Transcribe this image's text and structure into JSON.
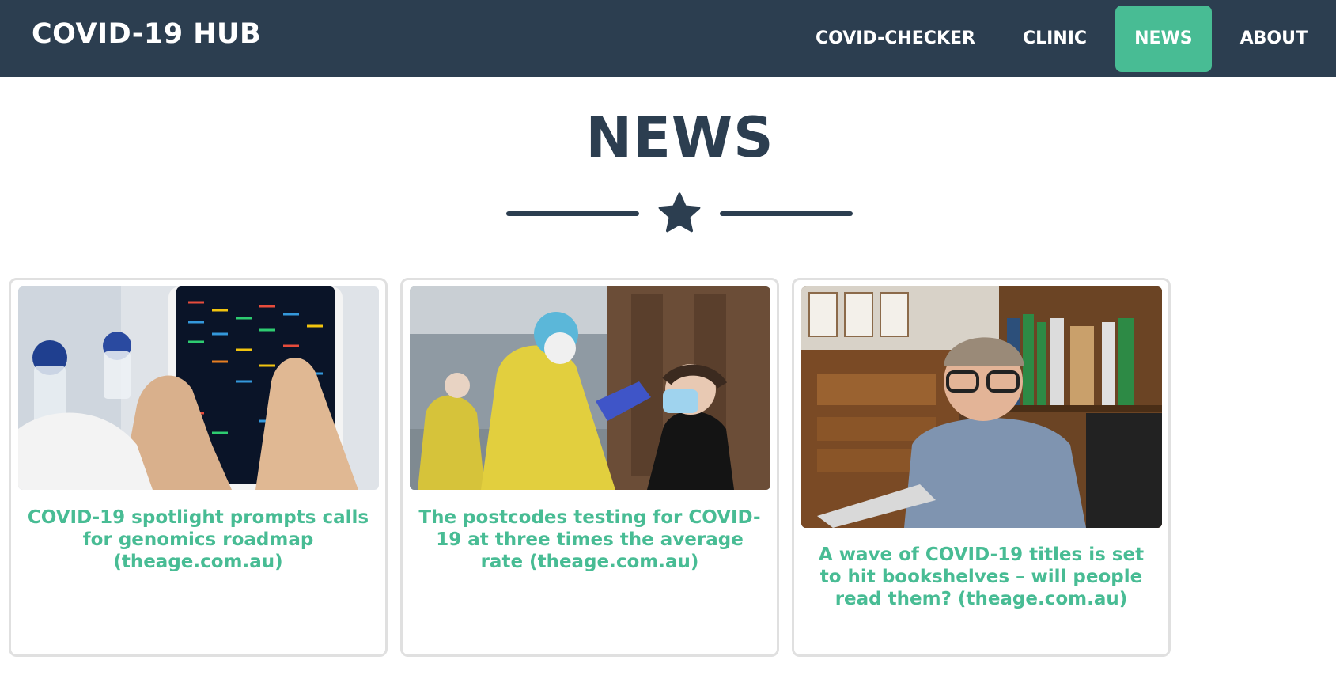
{
  "nav": {
    "brand": "COVID-19 HUB",
    "links": [
      {
        "label": "COVID-CHECKER"
      },
      {
        "label": "CLINIC"
      },
      {
        "label": "NEWS",
        "active": true
      },
      {
        "label": "ABOUT"
      }
    ]
  },
  "page": {
    "title": "NEWS"
  },
  "articles": [
    {
      "title": "COVID-19 spotlight prompts calls for genomics roadmap (theage.com.au)",
      "image": "genome-sequence-tablet-photo"
    },
    {
      "title": "The postcodes testing for COVID-19 at three times the average rate (theage.com.au)",
      "image": "covid-swab-test-photo"
    },
    {
      "title": "A wave of COVID-19 titles is set to hit bookshelves – will people read them? (theage.com.au)",
      "image": "author-at-desk-photo"
    }
  ],
  "colors": {
    "navbar": "#2c3e50",
    "accent": "#48bc94",
    "heading": "#2c3e50",
    "card_border": "#e0e0e0"
  }
}
